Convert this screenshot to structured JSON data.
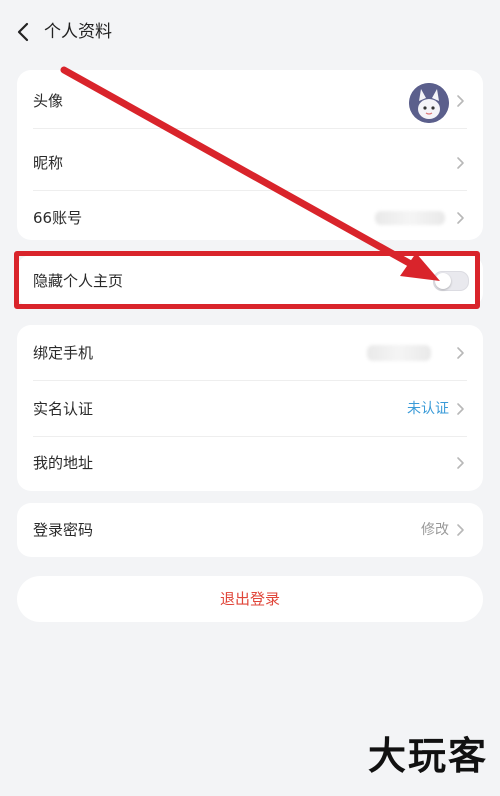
{
  "header": {
    "title": "个人资料"
  },
  "card1": {
    "rows": [
      {
        "label": "头像"
      },
      {
        "label": "昵称"
      },
      {
        "label": "66账号"
      }
    ]
  },
  "hide_homepage": {
    "label": "隐藏个人主页",
    "enabled": false
  },
  "card2": {
    "rows": [
      {
        "label": "绑定手机"
      },
      {
        "label": "实名认证",
        "value": "未认证"
      },
      {
        "label": "我的地址"
      }
    ]
  },
  "card3": {
    "rows": [
      {
        "label": "登录密码",
        "value": "修改"
      }
    ]
  },
  "logout": {
    "label": "退出登录"
  },
  "watermark": {
    "text": "大玩客"
  },
  "colors": {
    "accent_link": "#3a9bd8",
    "logout_red": "#e0463a",
    "annotation_red": "#d9242b"
  }
}
